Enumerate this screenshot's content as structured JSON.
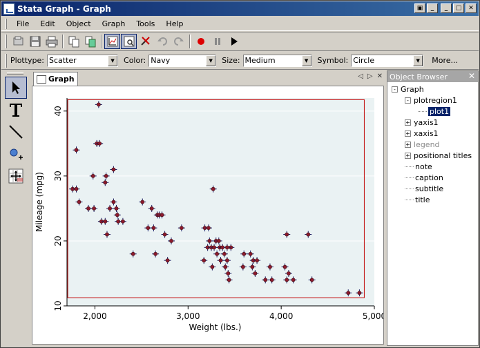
{
  "window": {
    "title": "Stata Graph - Graph"
  },
  "menubar": {
    "items": [
      {
        "label": "File",
        "key": "F"
      },
      {
        "label": "Edit",
        "key": "E"
      },
      {
        "label": "Object",
        "key": "O"
      },
      {
        "label": "Graph",
        "key": "G"
      },
      {
        "label": "Tools",
        "key": "T"
      },
      {
        "label": "Help",
        "key": "H"
      }
    ]
  },
  "toolbar": {
    "icons": [
      "open-icon",
      "save-icon",
      "print-icon",
      "copy-icon",
      "copy-graph-icon",
      "graph-editor-icon",
      "object-browser-icon",
      "delete-icon",
      "undo-icon",
      "redo-icon",
      "record-icon",
      "pause-icon",
      "play-icon"
    ]
  },
  "propbar": {
    "plottype_label": "Plottype:",
    "plottype_value": "Scatter",
    "color_label": "Color:",
    "color_value": "Navy",
    "size_label": "Size:",
    "size_value": "Medium",
    "symbol_label": "Symbol:",
    "symbol_value": "Circle",
    "more_label": "More..."
  },
  "graph_tab": {
    "label": "Graph"
  },
  "object_browser": {
    "title": "Object Browser",
    "tree": [
      {
        "label": "Graph",
        "level": 0,
        "expander": "-",
        "dim": false,
        "selected": false
      },
      {
        "label": "plotregion1",
        "level": 1,
        "expander": "-",
        "dim": false,
        "selected": false
      },
      {
        "label": "plot1",
        "level": 2,
        "expander": "",
        "dim": false,
        "selected": true
      },
      {
        "label": "yaxis1",
        "level": 1,
        "expander": "+",
        "dim": false,
        "selected": false
      },
      {
        "label": "xaxis1",
        "level": 1,
        "expander": "+",
        "dim": false,
        "selected": false
      },
      {
        "label": "legend",
        "level": 1,
        "expander": "+",
        "dim": true,
        "selected": false
      },
      {
        "label": "positional titles",
        "level": 1,
        "expander": "+",
        "dim": false,
        "selected": false
      },
      {
        "label": "note",
        "level": 1,
        "expander": "",
        "dim": false,
        "selected": false
      },
      {
        "label": "caption",
        "level": 1,
        "expander": "",
        "dim": false,
        "selected": false
      },
      {
        "label": "subtitle",
        "level": 1,
        "expander": "",
        "dim": false,
        "selected": false
      },
      {
        "label": "title",
        "level": 1,
        "expander": "",
        "dim": false,
        "selected": false
      }
    ]
  },
  "colors": {
    "marker_fill": "#8b1a2b",
    "marker_cross": "#1a1a60",
    "selection_box": "#c00000",
    "plot_bg": "#eaf2f3"
  },
  "chart_data": {
    "type": "scatter",
    "title": "",
    "xlabel": "Weight (lbs.)",
    "ylabel": "Mileage (mpg)",
    "xlim": [
      1700,
      5000
    ],
    "ylim": [
      10,
      42
    ],
    "xticks": [
      2000,
      3000,
      4000,
      5000
    ],
    "xtick_labels": [
      "2,000",
      "3,000",
      "4,000",
      "5,000"
    ],
    "yticks": [
      10,
      20,
      30,
      40
    ],
    "ytick_labels": [
      "10",
      "20",
      "30",
      "40"
    ],
    "grid": true,
    "series": [
      {
        "x": [
          2040,
          1800,
          1760,
          1800,
          1830,
          1930,
          1980,
          2020,
          2050,
          1990,
          2070,
          2110,
          2120,
          2130,
          2110,
          2160,
          2200,
          2200,
          2230,
          2240,
          2250,
          2300,
          2410,
          2510,
          2570,
          2610,
          2630,
          2650,
          2670,
          2690,
          2720,
          2750,
          2780,
          2820,
          2930,
          3170,
          3180,
          3210,
          3220,
          3230,
          3250,
          3260,
          3270,
          3280,
          3300,
          3310,
          3330,
          3340,
          3350,
          3370,
          3390,
          3400,
          3420,
          3430,
          3440,
          3460,
          3420,
          3590,
          3600,
          3670,
          3690,
          3700,
          3720,
          3740,
          3830,
          3880,
          3900,
          4040,
          4060,
          4060,
          4080,
          4130,
          4290,
          4330,
          4720,
          4840
        ],
        "y": [
          41,
          34,
          28,
          28,
          26,
          25,
          30,
          35,
          35,
          25,
          23,
          29,
          30,
          21,
          23,
          25,
          31,
          26,
          25,
          24,
          23,
          23,
          18,
          26,
          22,
          25,
          22,
          18,
          24,
          24,
          24,
          21,
          17,
          20,
          22,
          17,
          22,
          19,
          22,
          20,
          19,
          16,
          28,
          19,
          20,
          18,
          20,
          19,
          17,
          19,
          18,
          16,
          17,
          15,
          14,
          19,
          19,
          16,
          18,
          18,
          16,
          17,
          15,
          17,
          14,
          16,
          14,
          16,
          14,
          21,
          15,
          14,
          21,
          14,
          12,
          12
        ]
      }
    ]
  }
}
